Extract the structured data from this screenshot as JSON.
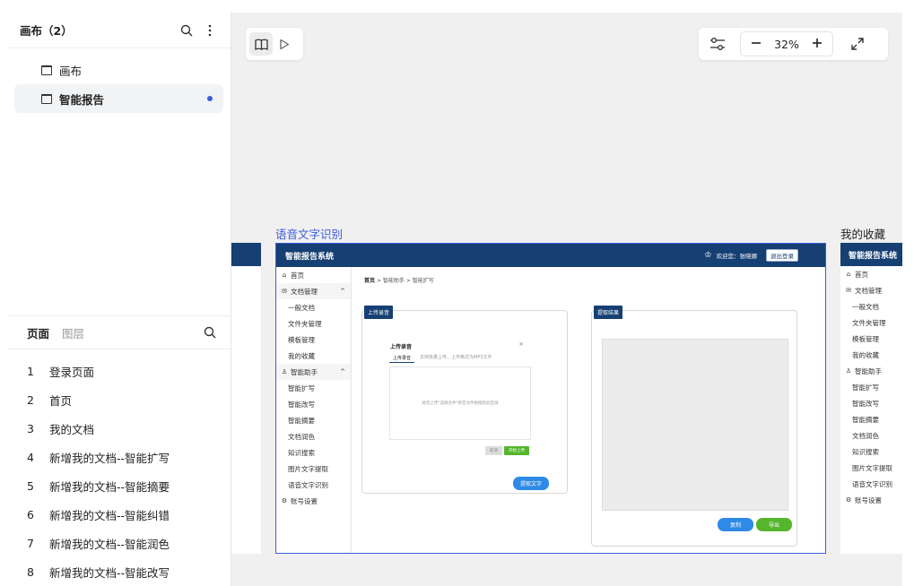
{
  "canvas_panel": {
    "title": "画布（2）",
    "items": [
      {
        "label": "画布",
        "active": false
      },
      {
        "label": "智能报告",
        "active": true
      }
    ]
  },
  "pages_panel": {
    "tabs": [
      {
        "label": "页面",
        "active": true
      },
      {
        "label": "图层",
        "active": false
      }
    ],
    "pages": [
      {
        "num": "1",
        "label": "登录页面"
      },
      {
        "num": "2",
        "label": "首页"
      },
      {
        "num": "3",
        "label": "我的文档"
      },
      {
        "num": "4",
        "label": "新增我的文档--智能扩写"
      },
      {
        "num": "5",
        "label": "新增我的文档--智能摘要"
      },
      {
        "num": "6",
        "label": "新增我的文档--智能纠错"
      },
      {
        "num": "7",
        "label": "新增我的文档--智能润色"
      },
      {
        "num": "8",
        "label": "新增我的文档--智能改写"
      }
    ]
  },
  "toolbar": {
    "zoom": "32%"
  },
  "frames": {
    "main_label": "语音文字识别",
    "right_label": "我的收藏"
  },
  "mock": {
    "app_title": "智能报告系统",
    "welcome": "欢迎您：张晓娜",
    "logout": "退出登录",
    "breadcrumb": {
      "home": "首页",
      "sep": ">",
      "level2": "智能助手",
      "level3": "智能扩写"
    },
    "sidebar": [
      {
        "icon": "home",
        "label": "首页",
        "type": "top"
      },
      {
        "icon": "mail",
        "label": "文档管理",
        "type": "group",
        "caret": "^"
      },
      {
        "label": "一般文档",
        "type": "sub"
      },
      {
        "label": "文件夹管理",
        "type": "sub"
      },
      {
        "label": "模板管理",
        "type": "sub"
      },
      {
        "label": "我的收藏",
        "type": "sub"
      },
      {
        "icon": "user",
        "label": "智能助手",
        "type": "group",
        "caret": "^"
      },
      {
        "label": "智能扩写",
        "type": "sub"
      },
      {
        "label": "智能改写",
        "type": "sub"
      },
      {
        "label": "智能摘要",
        "type": "sub"
      },
      {
        "label": "文档润色",
        "type": "sub"
      },
      {
        "label": "知识搜索",
        "type": "sub"
      },
      {
        "label": "图片文字提取",
        "type": "sub"
      },
      {
        "label": "语音文字识别",
        "type": "sub"
      },
      {
        "icon": "gear",
        "label": "账号设置",
        "type": "top"
      }
    ],
    "right_sidebar": [
      {
        "icon": "home",
        "label": "首页",
        "type": "top"
      },
      {
        "icon": "mail",
        "label": "文档管理",
        "type": "top"
      },
      {
        "label": "一般文档",
        "type": "sub"
      },
      {
        "label": "文件夹管理",
        "type": "sub"
      },
      {
        "label": "模板管理",
        "type": "sub"
      },
      {
        "label": "我的收藏",
        "type": "sub"
      },
      {
        "icon": "user",
        "label": "智能助手",
        "type": "top"
      },
      {
        "label": "智能扩写",
        "type": "sub"
      },
      {
        "label": "智能改写",
        "type": "sub"
      },
      {
        "label": "智能摘要",
        "type": "sub"
      },
      {
        "label": "文档润色",
        "type": "sub"
      },
      {
        "label": "知识搜索",
        "type": "sub"
      },
      {
        "label": "图片文字提取",
        "type": "sub"
      },
      {
        "label": "语音文字识别",
        "type": "sub"
      },
      {
        "icon": "gear",
        "label": "账号设置",
        "type": "top"
      }
    ],
    "upload_card": {
      "tag": "上传录音",
      "dialog_title": "上传录音",
      "tab_active": "上传录音",
      "tab_hint": "支持批量上传，上传格式为MP3文件",
      "drop_text": "将音上传\"选择文件\"将音文件拖拽到此区域",
      "cancel": "取消",
      "start": "开始上传",
      "extract": "提取文字"
    },
    "result_card": {
      "tag": "提取结果",
      "copy": "复制",
      "export": "导出"
    }
  }
}
